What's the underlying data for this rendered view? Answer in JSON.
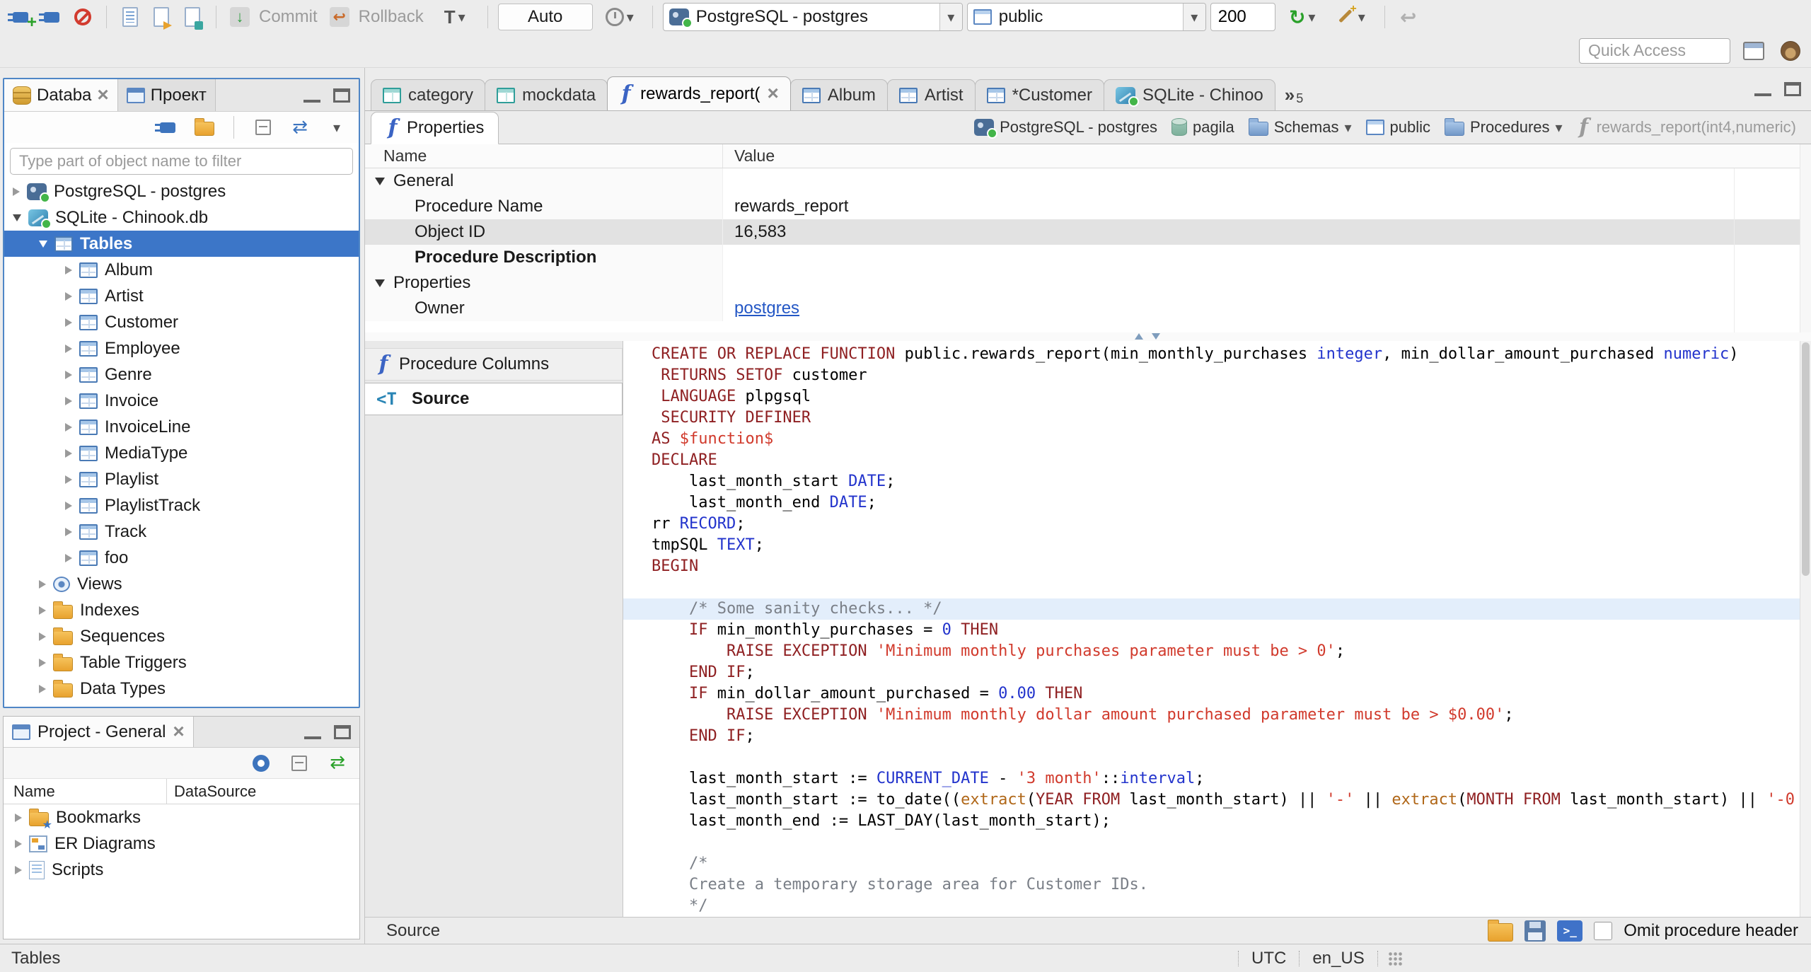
{
  "toolbar": {
    "commit_label": "Commit",
    "rollback_label": "Rollback",
    "auto_label": "Auto",
    "connection_combo": "PostgreSQL - postgres",
    "schema_combo": "public",
    "fetch_size": "200",
    "quick_access_placeholder": "Quick Access"
  },
  "sidebar": {
    "tabs": [
      {
        "label": "Databa",
        "active": true,
        "closable": true
      },
      {
        "label": "Проект",
        "active": false
      }
    ],
    "filter_placeholder": "Type part of object name to filter",
    "tree": [
      {
        "depth": 0,
        "arrow": "right",
        "icon": "postgres-db-icon",
        "label": "PostgreSQL - postgres"
      },
      {
        "depth": 0,
        "arrow": "down",
        "icon": "sqlite-db-icon",
        "label": "SQLite - Chinook.db"
      },
      {
        "depth": 1,
        "arrow": "down",
        "icon": "tables-icon",
        "label": "Tables",
        "selected": true
      },
      {
        "depth": 2,
        "arrow": "right",
        "icon": "table-icon",
        "label": "Album"
      },
      {
        "depth": 2,
        "arrow": "right",
        "icon": "table-icon",
        "label": "Artist"
      },
      {
        "depth": 2,
        "arrow": "right",
        "icon": "table-icon",
        "label": "Customer"
      },
      {
        "depth": 2,
        "arrow": "right",
        "icon": "table-icon",
        "label": "Employee"
      },
      {
        "depth": 2,
        "arrow": "right",
        "icon": "table-icon",
        "label": "Genre"
      },
      {
        "depth": 2,
        "arrow": "right",
        "icon": "table-icon",
        "label": "Invoice"
      },
      {
        "depth": 2,
        "arrow": "right",
        "icon": "table-icon",
        "label": "InvoiceLine"
      },
      {
        "depth": 2,
        "arrow": "right",
        "icon": "table-icon",
        "label": "MediaType"
      },
      {
        "depth": 2,
        "arrow": "right",
        "icon": "table-icon",
        "label": "Playlist"
      },
      {
        "depth": 2,
        "arrow": "right",
        "icon": "table-icon",
        "label": "PlaylistTrack"
      },
      {
        "depth": 2,
        "arrow": "right",
        "icon": "table-icon",
        "label": "Track"
      },
      {
        "depth": 2,
        "arrow": "right",
        "icon": "table-icon",
        "label": "foo"
      },
      {
        "depth": 1,
        "arrow": "right",
        "icon": "views-icon",
        "label": "Views"
      },
      {
        "depth": 1,
        "arrow": "right",
        "icon": "folder-icon",
        "label": "Indexes"
      },
      {
        "depth": 1,
        "arrow": "right",
        "icon": "folder-icon",
        "label": "Sequences"
      },
      {
        "depth": 1,
        "arrow": "right",
        "icon": "folder-icon",
        "label": "Table Triggers"
      },
      {
        "depth": 1,
        "arrow": "right",
        "icon": "folder-icon",
        "label": "Data Types"
      }
    ]
  },
  "project_panel": {
    "title": "Project - General",
    "columns": [
      "Name",
      "DataSource"
    ],
    "items": [
      {
        "icon": "bookmarks-folder-icon",
        "label": "Bookmarks"
      },
      {
        "icon": "er-diagram-icon",
        "label": "ER Diagrams"
      },
      {
        "icon": "scripts-icon",
        "label": "Scripts"
      }
    ]
  },
  "editor": {
    "tabs": [
      {
        "label": "category",
        "icon": "view-icon"
      },
      {
        "label": "mockdata",
        "icon": "view-icon"
      },
      {
        "label": "rewards_report(",
        "icon": "function-icon",
        "active": true,
        "closable": true
      },
      {
        "label": "Album",
        "icon": "table-icon"
      },
      {
        "label": "Artist",
        "icon": "table-icon"
      },
      {
        "label": "*Customer",
        "icon": "table-icon"
      },
      {
        "label": "SQLite - Chinoo",
        "icon": "sqlite-db-icon"
      }
    ],
    "overflow_count": "5",
    "properties_tab": "Properties",
    "breadcrumb": [
      {
        "label": "PostgreSQL - postgres",
        "icon": "postgres-db-icon"
      },
      {
        "label": "pagila",
        "icon": "database-icon"
      },
      {
        "label": "Schemas",
        "icon": "blue-folder-icon",
        "dropdown": true
      },
      {
        "label": "public",
        "icon": "schema-icon"
      },
      {
        "label": "Procedures",
        "icon": "blue-folder-icon",
        "dropdown": true
      },
      {
        "label": "rewards_report(int4,numeric)",
        "icon": "function-icon",
        "muted": true
      }
    ],
    "grid": {
      "name_header": "Name",
      "value_header": "Value",
      "rows": [
        {
          "kind": "group",
          "name": "General"
        },
        {
          "kind": "prop",
          "name": "Procedure Name",
          "value": "rewards_report"
        },
        {
          "kind": "prop",
          "name": "Object ID",
          "value": "16,583",
          "selected": true
        },
        {
          "kind": "prop",
          "name": "Procedure Description",
          "value": "",
          "bold": true
        },
        {
          "kind": "group",
          "name": "Properties"
        },
        {
          "kind": "prop",
          "name": "Owner",
          "value": "postgres",
          "link": true
        }
      ]
    },
    "side_tabs": [
      {
        "label": "Procedure Columns",
        "icon": "function-icon"
      },
      {
        "label": "Source",
        "icon": "source-icon",
        "active": true
      }
    ],
    "bottom": {
      "label": "Source",
      "omit_checkbox_label": "Omit procedure header"
    }
  },
  "code": {
    "highlight_line": 12,
    "lines": [
      [
        {
          "t": "CREATE OR REPLACE FUNCTION",
          "c": "kw"
        },
        {
          "t": " public.rewards_report(min_monthly_purchases "
        },
        {
          "t": "integer",
          "c": "type"
        },
        {
          "t": ", min_dollar_amount_purchased "
        },
        {
          "t": "numeric",
          "c": "type"
        },
        {
          "t": ")"
        }
      ],
      [
        {
          "t": " "
        },
        {
          "t": "RETURNS SETOF",
          "c": "kw"
        },
        {
          "t": " customer"
        }
      ],
      [
        {
          "t": " "
        },
        {
          "t": "LANGUAGE",
          "c": "kw"
        },
        {
          "t": " plpgsql"
        }
      ],
      [
        {
          "t": " "
        },
        {
          "t": "SECURITY DEFINER",
          "c": "kw"
        }
      ],
      [
        {
          "t": "AS",
          "c": "kw"
        },
        {
          "t": " "
        },
        {
          "t": "$function$",
          "c": "str"
        }
      ],
      [
        {
          "t": "DECLARE",
          "c": "kw"
        }
      ],
      [
        {
          "t": "    last_month_start "
        },
        {
          "t": "DATE",
          "c": "type"
        },
        {
          "t": ";"
        }
      ],
      [
        {
          "t": "    last_month_end "
        },
        {
          "t": "DATE",
          "c": "type"
        },
        {
          "t": ";"
        }
      ],
      [
        {
          "t": "rr "
        },
        {
          "t": "RECORD",
          "c": "type"
        },
        {
          "t": ";"
        }
      ],
      [
        {
          "t": "tmpSQL "
        },
        {
          "t": "TEXT",
          "c": "type"
        },
        {
          "t": ";"
        }
      ],
      [
        {
          "t": "BEGIN",
          "c": "kw"
        }
      ],
      [],
      [
        {
          "t": "    "
        },
        {
          "t": "/* Some sanity checks... */",
          "c": "com"
        }
      ],
      [
        {
          "t": "    "
        },
        {
          "t": "IF",
          "c": "kw"
        },
        {
          "t": " min_monthly_purchases = "
        },
        {
          "t": "0",
          "c": "num"
        },
        {
          "t": " "
        },
        {
          "t": "THEN",
          "c": "kw"
        }
      ],
      [
        {
          "t": "        "
        },
        {
          "t": "RAISE EXCEPTION",
          "c": "kw"
        },
        {
          "t": " "
        },
        {
          "t": "'Minimum monthly purchases parameter must be > 0'",
          "c": "str"
        },
        {
          "t": ";"
        }
      ],
      [
        {
          "t": "    "
        },
        {
          "t": "END IF",
          "c": "kw"
        },
        {
          "t": ";"
        }
      ],
      [
        {
          "t": "    "
        },
        {
          "t": "IF",
          "c": "kw"
        },
        {
          "t": " min_dollar_amount_purchased = "
        },
        {
          "t": "0.00",
          "c": "num"
        },
        {
          "t": " "
        },
        {
          "t": "THEN",
          "c": "kw"
        }
      ],
      [
        {
          "t": "        "
        },
        {
          "t": "RAISE EXCEPTION",
          "c": "kw"
        },
        {
          "t": " "
        },
        {
          "t": "'Minimum monthly dollar amount purchased parameter must be > $0.00'",
          "c": "str"
        },
        {
          "t": ";"
        }
      ],
      [
        {
          "t": "    "
        },
        {
          "t": "END IF",
          "c": "kw"
        },
        {
          "t": ";"
        }
      ],
      [],
      [
        {
          "t": "    last_month_start := "
        },
        {
          "t": "CURRENT_DATE",
          "c": "type"
        },
        {
          "t": " - "
        },
        {
          "t": "'3 month'",
          "c": "str"
        },
        {
          "t": "::"
        },
        {
          "t": "interval",
          "c": "type"
        },
        {
          "t": ";"
        }
      ],
      [
        {
          "t": "    last_month_start := to_date(("
        },
        {
          "t": "extract",
          "c": "fn"
        },
        {
          "t": "("
        },
        {
          "t": "YEAR FROM",
          "c": "kw"
        },
        {
          "t": " last_month_start) || "
        },
        {
          "t": "'-'",
          "c": "str"
        },
        {
          "t": " || "
        },
        {
          "t": "extract",
          "c": "fn"
        },
        {
          "t": "("
        },
        {
          "t": "MONTH FROM",
          "c": "kw"
        },
        {
          "t": " last_month_start) || "
        },
        {
          "t": "'-0",
          "c": "str"
        }
      ],
      [
        {
          "t": "    last_month_end := LAST_DAY(last_month_start);"
        }
      ],
      [],
      [
        {
          "t": "    "
        },
        {
          "t": "/*",
          "c": "com"
        }
      ],
      [
        {
          "t": "    "
        },
        {
          "t": "Create a temporary storage area for Customer IDs.",
          "c": "com"
        }
      ],
      [
        {
          "t": "    "
        },
        {
          "t": "*/",
          "c": "com"
        }
      ]
    ]
  },
  "statusbar": {
    "left": "Tables",
    "timezone": "UTC",
    "locale": "en_US"
  },
  "colors": {
    "selection": "#3c76c8",
    "link": "#2457c5",
    "keyword": "#8f2022",
    "datatype": "#2233cc",
    "string": "#d13a2c",
    "comment": "#7a7f87",
    "function": "#b06718",
    "line_highlight": "#e3eefb",
    "status_green": "#43b549"
  }
}
